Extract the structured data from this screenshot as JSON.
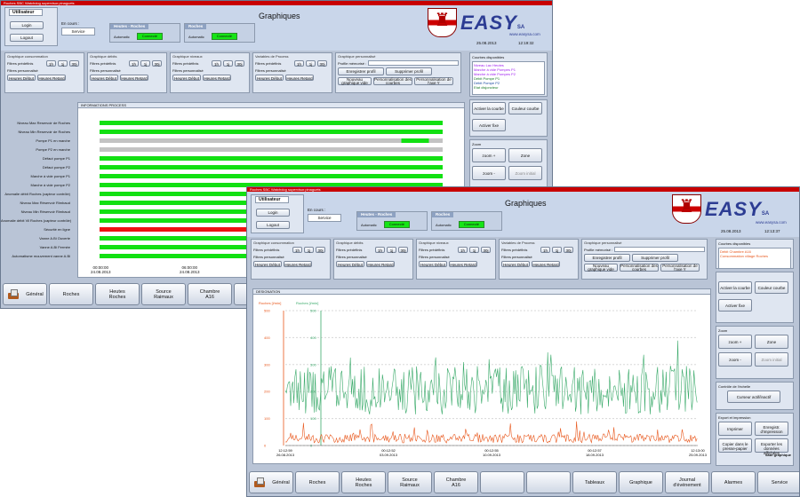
{
  "win1": {
    "titlebar": "Roches SBC Watchdog supervisor.pinaguets",
    "page_title": "Graphiques",
    "user_box": {
      "label": "Utilisateur",
      "login": "Login",
      "logout": "Logout"
    },
    "en_cours": {
      "label": "En cours :",
      "value": "Service"
    },
    "mode_boxes": [
      {
        "title": "Heutes - Roches",
        "mode": "Automatic",
        "status": "Connecté"
      },
      {
        "title": "Roches",
        "mode": "Automatic",
        "status": "Connecté"
      }
    ],
    "logo": {
      "name": "EASY",
      "suffix": "SA",
      "tagline": "www.easysa.com"
    },
    "date": "25.08.2013",
    "time": "12:19:32",
    "panels": [
      {
        "title": "Graphique consommation",
        "filter1": "Filtres prédéfinis",
        "filter2": "Filtres personnalisé",
        "s": [
          "1h",
          "1j",
          "30j"
        ],
        "b1": "Heures Début",
        "b2": "Heures Retard"
      },
      {
        "title": "Graphique débits",
        "filter1": "Filtres prédéfinis",
        "filter2": "Filtres personnalisé",
        "s": [
          "1h",
          "1j",
          "30j"
        ],
        "b1": "Heures Début",
        "b2": "Heures Retard"
      },
      {
        "title": "Graphique niveaux",
        "filter1": "Filtres prédéfinis",
        "filter2": "Filtres personnalisé",
        "s": [
          "1h",
          "1j",
          "30j"
        ],
        "b1": "Heures Début",
        "b2": "Heures Retard"
      },
      {
        "title": "Variables de Process",
        "filter1": "Filtres prédéfinis",
        "filter2": "Filtres personnalisé",
        "s": [
          "1h",
          "1j",
          "30j"
        ],
        "b1": "Heures Début",
        "b2": "Heures Retard"
      }
    ],
    "profile_panel": {
      "title": "Graphique personnalisé",
      "profil": "Profile mémorisé :",
      "b": [
        "Enregistrer profil",
        "Supprimer profil",
        "Nouveau graphique vide",
        "Personnalisation des courbes",
        "Personnalisation de l'axe Y"
      ]
    },
    "courbes": {
      "title": "Courbes disponibles",
      "items": [
        "Niveau Lac Heutes",
        "Marche à vide Pompes P1",
        "Marche à vide Pompes P2",
        "Débit Pompe P1",
        "Débit Pompe P2",
        "Etat disjoncteur"
      ]
    },
    "side_buttons": {
      "activate": "Activer la courbe",
      "color": "Couleur courbe",
      "fixe": "Activer fixe"
    },
    "zoom": {
      "title": "Zoom",
      "zoom_in": "zoom +",
      "zoom_out": "zoom -",
      "zone": "Zone",
      "reset": "Zoom initial"
    },
    "info_caption": "INFORMATIONS PROCESS",
    "process_rows": [
      {
        "label": "Niveau Max Reservoir de Roches",
        "state": "on"
      },
      {
        "label": "Niveau Min Reservoir de Roches",
        "state": "on"
      },
      {
        "label": "Pompe P1 en marche",
        "state": "partial"
      },
      {
        "label": "Pompe P2 en marche",
        "state": "off"
      },
      {
        "label": "Défaut pompe P1",
        "state": "on"
      },
      {
        "label": "Défaut pompe P2",
        "state": "on"
      },
      {
        "label": "Marche à vide pompe P1",
        "state": "on"
      },
      {
        "label": "Marche à vide pompe P2",
        "state": "on"
      },
      {
        "label": "Anomalie débit Roches (capteur contrôle)",
        "state": "on"
      },
      {
        "label": "Niveau Max Réservoir Rimbaud",
        "state": "on"
      },
      {
        "label": "Niveau Min Réservoir Rimbaud",
        "state": "on"
      },
      {
        "label": "Anomalie débit Vil Roches (capteur contrôle)",
        "state": "on"
      },
      {
        "label": "Sécurité en ligne",
        "state": "alarm"
      },
      {
        "label": "Vanne A.Bi Ouverte",
        "state": "on"
      },
      {
        "label": "Vanne A.Bi Fermée",
        "state": "on"
      },
      {
        "label": "Automatisme mouvement vanne A.Bi",
        "state": "on"
      }
    ],
    "time_ticks": [
      {
        "t": "00:00:00",
        "d": "24.08.2013"
      },
      {
        "t": "06:00:00",
        "d": "24.08.2013"
      }
    ],
    "nav": [
      "Général",
      "Roches",
      "Heutes\nRoches",
      "Source\nRaimaux",
      "Chambre\nA16",
      ""
    ]
  },
  "win2": {
    "titlebar": "Roches SBC Watchdog supervisor.pinaguets",
    "page_title": "Graphiques",
    "user_box": {
      "label": "Utilisateur",
      "login": "Login",
      "logout": "Logout"
    },
    "en_cours": {
      "label": "En cours :",
      "value": "Service"
    },
    "mode_boxes": [
      {
        "title": "Heutes - Roches",
        "mode": "Automatic",
        "status": "Connecté"
      },
      {
        "title": "Roches",
        "mode": "Automatic",
        "status": "Connecté"
      }
    ],
    "logo": {
      "name": "EASY",
      "suffix": "SA",
      "tagline": "www.easysa.com"
    },
    "date": "25.08.2013",
    "time": "12:13:37",
    "panels": [
      {
        "title": "Graphique consommation",
        "filter1": "Filtres prédéfinis",
        "filter2": "Filtres personnalisé",
        "s": [
          "1h",
          "1j",
          "30j"
        ],
        "b1": "Heures Début",
        "b2": "Heures Retard"
      },
      {
        "title": "Graphique débits",
        "filter1": "Filtres prédéfinis",
        "filter2": "Filtres personnalisé",
        "s": [
          "1h",
          "1j",
          "30j"
        ],
        "b1": "Heures Début",
        "b2": "Heures Retard"
      },
      {
        "title": "Graphique niveaux",
        "filter1": "Filtres prédéfinis",
        "filter2": "Filtres personnalisé",
        "s": [
          "1h",
          "1j",
          "30j"
        ],
        "b1": "Heures Début",
        "b2": "Heures Retard"
      },
      {
        "title": "Variables de Process",
        "filter1": "Filtres prédéfinis",
        "filter2": "Filtres personnalisé",
        "s": [
          "1h",
          "1j",
          "30j"
        ],
        "b1": "Heures Début",
        "b2": "Heures Retard"
      }
    ],
    "profile_panel": {
      "title": "Graphique personnalisé",
      "profil": "Profile mémorisé :",
      "b": [
        "Enregistrer profil",
        "Supprimer profil",
        "Nouveau graphique vide",
        "Personnalisation des courbes",
        "Personnalisation de l'axe Y"
      ]
    },
    "courbes": {
      "title": "Courbes disponibles",
      "items": [
        "Débit Chambre A16",
        "Consommation village Roches"
      ]
    },
    "side_buttons": {
      "activate": "Activer la courbe",
      "color": "Couleur courbe",
      "fixe": "Activer fixe"
    },
    "zoom": {
      "title": "Zoom",
      "zoom_in": "zoom +",
      "zoom_out": "zoom -",
      "zone": "Zone",
      "reset": "Zoom initial"
    },
    "curseur": {
      "title": "Contrôle de l'échelle",
      "button": "Curseur actif/inactif"
    },
    "export": {
      "title": "Export et impression",
      "b": [
        "Imprimer",
        "Enregistr. d'impression",
        "Copier dans le presse-papier",
        "Exporter les données affichées"
      ],
      "footer": "Sauf graphique"
    },
    "chart_caption": "DESIGNATION",
    "chart_data": {
      "type": "line",
      "series": [
        {
          "name": "Roches [l/min]",
          "color": "#3aaa6a"
        },
        {
          "name": "Roches [l/min]",
          "color": "#e8571c"
        }
      ],
      "yticks_left": [
        "500",
        "400",
        "300",
        "200",
        "100",
        "0"
      ],
      "yticks_right": [
        "500",
        "400",
        "300",
        "200",
        "100",
        "0"
      ],
      "x_ticks": [
        {
          "t": "12:12:59",
          "d": "26.08.2013"
        },
        {
          "t": "00:12:52",
          "d": "03.09.2013"
        },
        {
          "t": "00:12:55",
          "d": "10.09.2013"
        },
        {
          "t": "00:12:57",
          "d": "18.09.2013"
        },
        {
          "t": "12:13:00",
          "d": "25.09.2013"
        }
      ]
    },
    "nav": [
      "Général",
      "Roches",
      "Heutes\nRoches",
      "Source\nRaimaux",
      "Chambre\nA16",
      "",
      "",
      "Tableaux",
      "Graphique",
      "Journal\nd'événement",
      "Alarmes",
      "Service"
    ]
  },
  "colors": {
    "green": "#15e515",
    "bar_green": "#12e012",
    "bar_gray": "#c3c3c3",
    "bar_red": "#ee1111",
    "easy_blue": "#2c3c93"
  }
}
